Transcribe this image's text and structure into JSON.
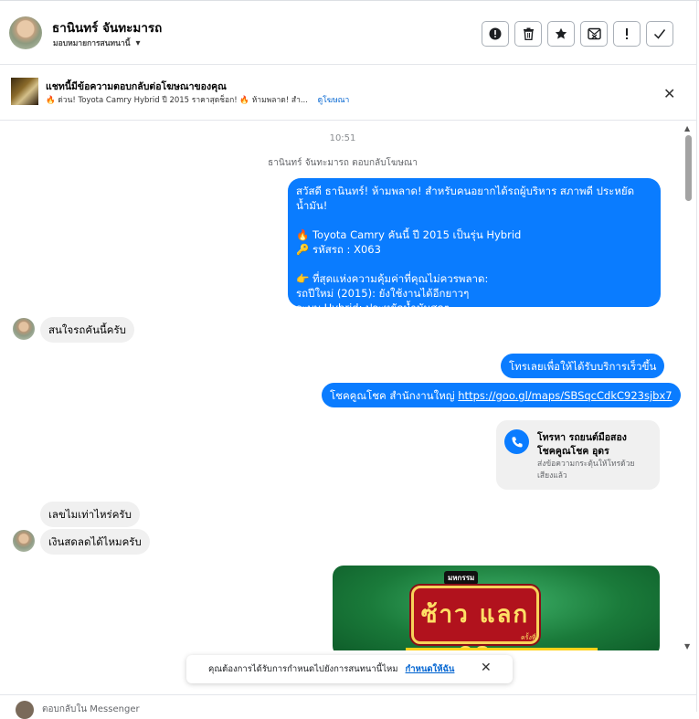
{
  "header": {
    "contact_name": "ธานินทร์ จันทะมารถ",
    "assign_label": "มอบหมายการสนทนานี้",
    "icons": [
      "alert-circle-icon",
      "trash-icon",
      "star-icon",
      "mail-x-icon",
      "exclamation-icon",
      "check-icon"
    ]
  },
  "ad_banner": {
    "title": "แชทนี้มีข้อความตอบกลับต่อโฆษณาของคุณ",
    "subtitle": "🔥 ด่วน! Toyota Camry Hybrid ปี 2015 ราคาสุดช็อก! 🔥 ห้ามพลาด! สำ...",
    "view_ad": "ดูโฆษณา"
  },
  "chat": {
    "time": "10:51",
    "system_note": "ธานินทร์ จันทะมารถ ตอบกลับโฆษณา",
    "ad_message": {
      "line1": "สวัสดี ธานินทร์! ห้ามพลาด! สำหรับคนอยากได้รถผู้บริหาร สภาพดี ประหยัดน้ำมัน!",
      "line2": "🔥 Toyota Camry คันนี้ ปี 2015 เป็นรุ่น Hybrid",
      "line3": "🔑 รหัสรถ : X063",
      "line4": "👉 ที่สุดแห่งความคุ้มค่าที่คุณไม่ควรพลาด:",
      "line5": "รถปีใหม่ (2015): ยังใช้งานได้อีกยาวๆ",
      "line6": "ระบบ Hybrid: ประหยัดน้ำมันสุดๆ"
    },
    "incoming1": "สนใจรถคันนี้ครับ",
    "outgoing_call": "โทรเลยเพื่อให้ได้รับบริการเร็วขึ้น",
    "outgoing_location_text": "โชคคูณโชค สำนักงานใหญ่",
    "outgoing_location_link": "https://goo.gl/maps/SBSqcCdkC923sjbx7",
    "call_card": {
      "title_line1": "โทรหา รถยนต์มือสอง",
      "title_line2": "โชคคูณโชค อุดร",
      "desc_line1": "ส่งข้อความกระตุ้นให้โทรด้วย",
      "desc_line2": "เสียงแล้ว"
    },
    "incoming2": "เลขไมเท่าไหร่ครับ",
    "incoming3": "เงินสดลดได้ไหมครับ",
    "promo_image": {
      "tag": "มหกรรม",
      "headline": "ซ้าว แลก ลด",
      "tag2": "ครั้งที่"
    }
  },
  "toast": {
    "message": "คุณต้องการได้รับการกำหนดไปยังการสนทนานี้ไหม",
    "action": "กำหนดให้ฉัน"
  },
  "composer": {
    "placeholder": "ตอบกลับใน Messenger"
  }
}
